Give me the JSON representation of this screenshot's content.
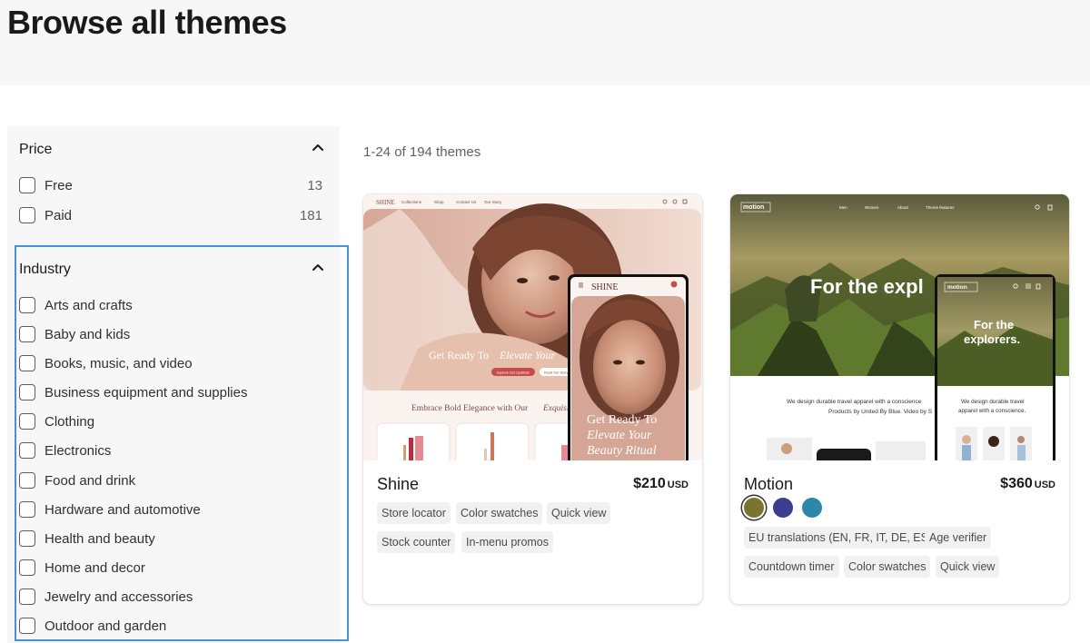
{
  "page": {
    "title": "Browse all themes"
  },
  "filters": {
    "price": {
      "title": "Price",
      "options": [
        {
          "label": "Free",
          "count": "13"
        },
        {
          "label": "Paid",
          "count": "181"
        }
      ]
    },
    "industry": {
      "title": "Industry",
      "options": [
        {
          "label": "Arts and crafts"
        },
        {
          "label": "Baby and kids"
        },
        {
          "label": "Books, music, and video"
        },
        {
          "label": "Business equipment and supplies"
        },
        {
          "label": "Clothing"
        },
        {
          "label": "Electronics"
        },
        {
          "label": "Food and drink"
        },
        {
          "label": "Hardware and automotive"
        },
        {
          "label": "Health and beauty"
        },
        {
          "label": "Home and decor"
        },
        {
          "label": "Jewelry and accessories"
        },
        {
          "label": "Outdoor and garden"
        }
      ]
    }
  },
  "results": {
    "count_text": "1-24 of 194 themes"
  },
  "themes": [
    {
      "name": "Shine",
      "price": "$210",
      "currency": "USD",
      "tags": [
        "Store locator",
        "Color swatches",
        "Quick view",
        "Stock counter",
        "In-menu promos"
      ],
      "preview": {
        "logo": "SHINE",
        "nav": [
          "Collections",
          "Shop",
          "Contact Us",
          "Our Story"
        ],
        "hero_text": "Get Ready To",
        "hero_text_italic": "Elevate Your",
        "primary_cta": "Explore Our Lipsticks",
        "secondary_cta": "Read Our Story",
        "section_heading": "Embrace Bold Elegance with Our",
        "section_heading_italic": "Exquisite",
        "mobile_logo": "SHINE",
        "mobile_hero_line1": "Get Ready To",
        "mobile_hero_line2": "Elevate Your",
        "mobile_hero_line3": "Beauty Ritual"
      }
    },
    {
      "name": "Motion",
      "price": "$360",
      "currency": "USD",
      "swatches": [
        "#7a7430",
        "#3d3d8f",
        "#2e86ab"
      ],
      "tags": [
        "EU translations (EN, FR, IT, DE, ES)",
        "Age verifier",
        "Countdown timer",
        "Color swatches",
        "Quick view"
      ],
      "preview": {
        "logo": "motion",
        "nav": [
          "Men",
          "Women",
          "About",
          "Theme features"
        ],
        "hero_text": "For the expl",
        "body_line1": "We design durable travel apparel with a conscience",
        "body_line2": "Products by United By Blue. Video by S",
        "mobile_logo": "motion",
        "mobile_hero_line1": "For the",
        "mobile_hero_line2": "explorers.",
        "mobile_body_line1": "We design durable travel",
        "mobile_body_line2": "apparel with a conscience."
      }
    }
  ]
}
